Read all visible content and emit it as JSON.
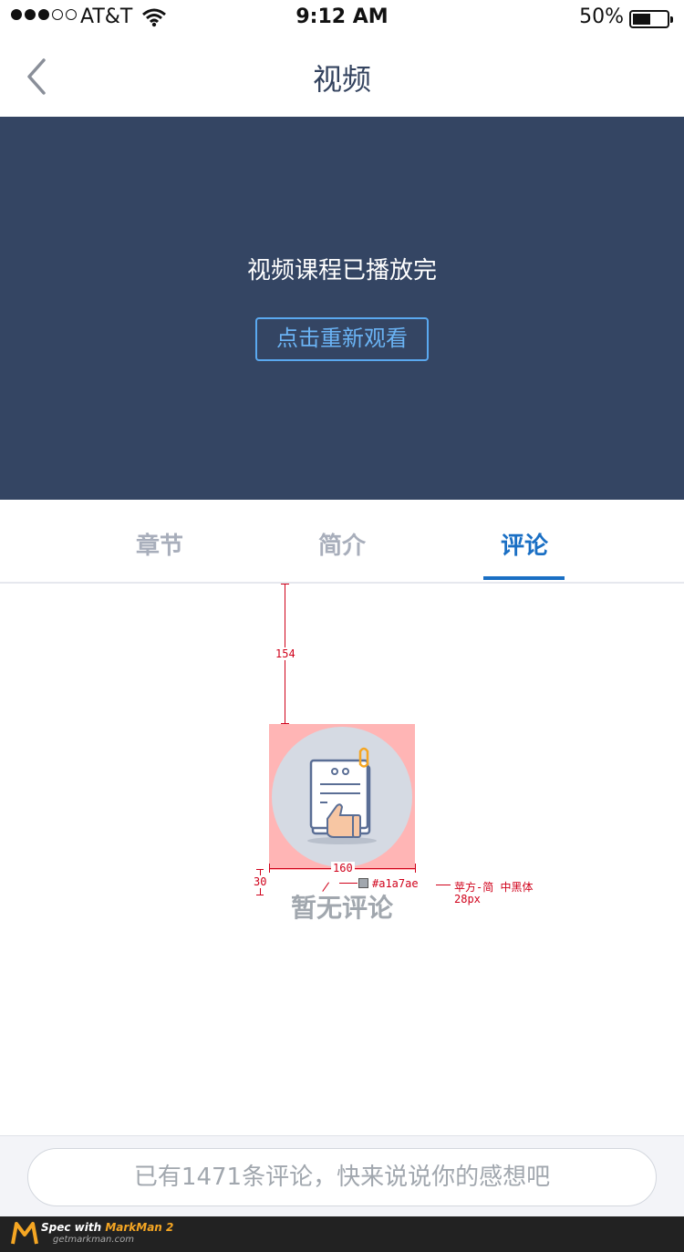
{
  "status": {
    "carrier": "AT&T",
    "time": "9:12 AM",
    "battery": "50%",
    "battery_level": 0.5
  },
  "nav": {
    "title": "视频"
  },
  "video": {
    "message": "视频课程已播放完",
    "replay_label": "点击重新观看"
  },
  "tabs": [
    {
      "label": "章节",
      "active": false
    },
    {
      "label": "简介",
      "active": false
    },
    {
      "label": "评论",
      "active": true
    }
  ],
  "empty_state": {
    "text": "暂无评论",
    "icon": "document-thumbs-up-icon"
  },
  "annotations": {
    "top_spacing": "154",
    "icon_width": "160",
    "text_spacing": "30",
    "text_color": "#a1a7ae",
    "font_note_1": "苹方-简  中黑体",
    "font_note_2": "28px"
  },
  "comment_bar": {
    "placeholder": "已有1471条评论，快来说说你的感想吧"
  },
  "watermark": {
    "line1_prefix": "Spec with ",
    "line1_brand": "MarkMan 2",
    "line2": "getmarkman.com"
  },
  "colors": {
    "nav_title": "#34435f",
    "video_bg": "#344563",
    "replay_border": "#5aa9f0",
    "tab_active": "#1a6fc4",
    "tab_inactive": "#a8aebb",
    "empty_text": "#a1a7ae",
    "annotation": "#d0021b"
  }
}
